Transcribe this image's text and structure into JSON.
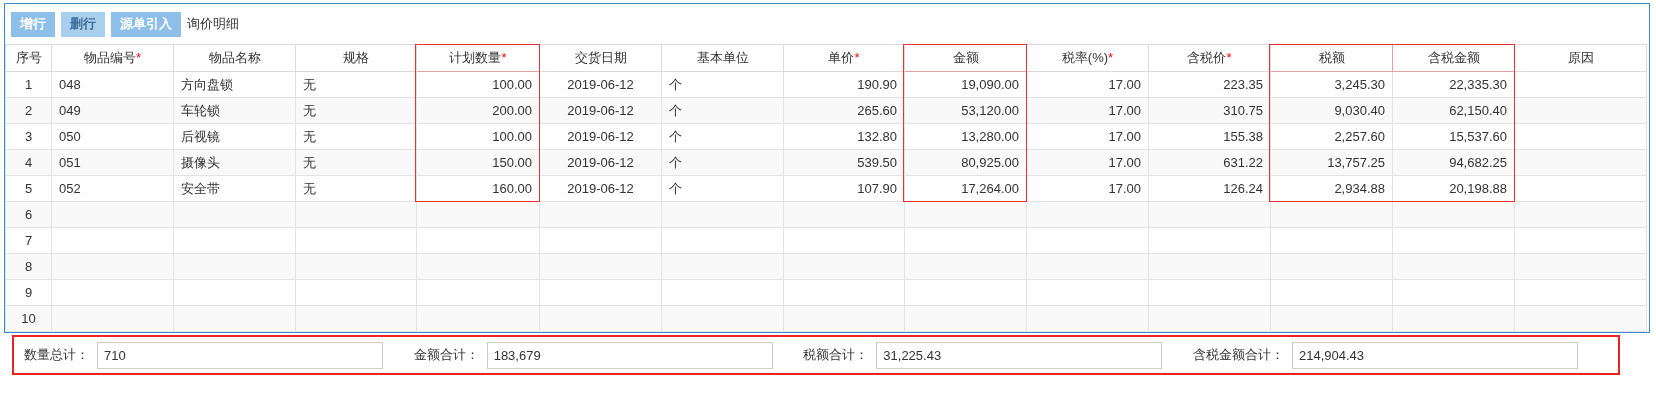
{
  "toolbar": {
    "buttons": [
      {
        "label": "增行",
        "disabled": false
      },
      {
        "label": "删行",
        "disabled": true
      },
      {
        "label": "源单引入",
        "disabled": false
      }
    ],
    "title": "询价明细"
  },
  "table": {
    "columns": [
      {
        "label": "序号",
        "kind": "index",
        "highlighted": false
      },
      {
        "label": "物品编号",
        "required_mark": "*",
        "kind": "text",
        "highlighted": false
      },
      {
        "label": "物品名称",
        "kind": "text",
        "highlighted": false
      },
      {
        "label": "规格",
        "kind": "text",
        "highlighted": false
      },
      {
        "label": "计划数量",
        "required_mark": "*",
        "kind": "number",
        "highlighted": true
      },
      {
        "label": "交货日期",
        "kind": "date",
        "highlighted": false
      },
      {
        "label": "基本单位",
        "kind": "text",
        "highlighted": false
      },
      {
        "label": "单价",
        "required_mark": "*",
        "kind": "number",
        "highlighted": false
      },
      {
        "label": "金额",
        "kind": "number",
        "highlighted": true
      },
      {
        "label": "税率(%)",
        "required_mark": "*",
        "kind": "number",
        "highlighted": false
      },
      {
        "label": "含税价",
        "required_mark": "*",
        "kind": "number",
        "highlighted": false
      },
      {
        "label": "税额",
        "kind": "number",
        "highlighted": true
      },
      {
        "label": "含税金额",
        "kind": "number",
        "highlighted": true
      },
      {
        "label": "原因",
        "kind": "text",
        "highlighted": false
      }
    ],
    "rows": [
      [
        "1",
        "048",
        "方向盘锁",
        "无",
        "100.00",
        "2019-06-12",
        "个",
        "190.90",
        "19,090.00",
        "17.00",
        "223.35",
        "3,245.30",
        "22,335.30",
        ""
      ],
      [
        "2",
        "049",
        "车轮锁",
        "无",
        "200.00",
        "2019-06-12",
        "个",
        "265.60",
        "53,120.00",
        "17.00",
        "310.75",
        "9,030.40",
        "62,150.40",
        ""
      ],
      [
        "3",
        "050",
        "后视镜",
        "无",
        "100.00",
        "2019-06-12",
        "个",
        "132.80",
        "13,280.00",
        "17.00",
        "155.38",
        "2,257.60",
        "15,537.60",
        ""
      ],
      [
        "4",
        "051",
        "摄像头",
        "无",
        "150.00",
        "2019-06-12",
        "个",
        "539.50",
        "80,925.00",
        "17.00",
        "631.22",
        "13,757.25",
        "94,682.25",
        ""
      ],
      [
        "5",
        "052",
        "安全带",
        "无",
        "160.00",
        "2019-06-12",
        "个",
        "107.90",
        "17,264.00",
        "17.00",
        "126.24",
        "2,934.88",
        "20,198.88",
        ""
      ],
      [
        "6",
        "",
        "",
        "",
        "",
        "",
        "",
        "",
        "",
        "",
        "",
        "",
        "",
        ""
      ],
      [
        "7",
        "",
        "",
        "",
        "",
        "",
        "",
        "",
        "",
        "",
        "",
        "",
        "",
        ""
      ],
      [
        "8",
        "",
        "",
        "",
        "",
        "",
        "",
        "",
        "",
        "",
        "",
        "",
        "",
        ""
      ],
      [
        "9",
        "",
        "",
        "",
        "",
        "",
        "",
        "",
        "",
        "",
        "",
        "",
        "",
        ""
      ],
      [
        "10",
        "",
        "",
        "",
        "",
        "",
        "",
        "",
        "",
        "",
        "",
        "",
        "",
        ""
      ]
    ]
  },
  "totals": [
    {
      "label": "数量总计：",
      "value": "710"
    },
    {
      "label": "金额合计：",
      "value": "183,679"
    },
    {
      "label": "税额合计：",
      "value": "31,225.43"
    },
    {
      "label": "含税金额合计：",
      "value": "214,904.43"
    }
  ]
}
